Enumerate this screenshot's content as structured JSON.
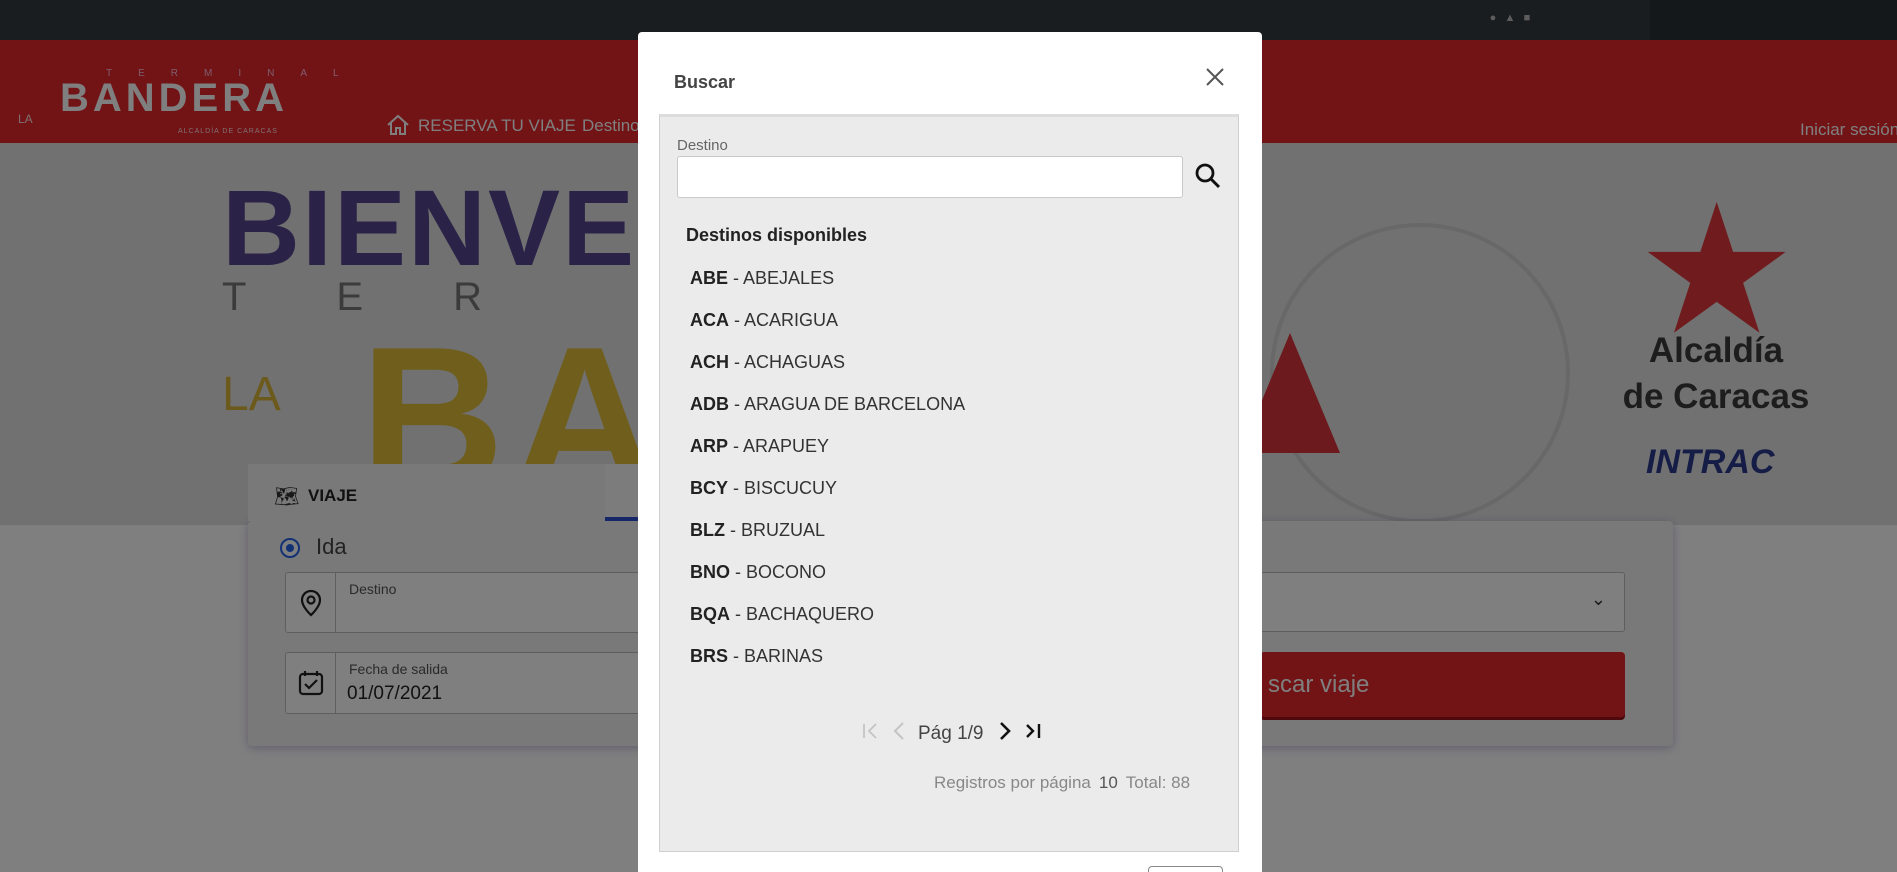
{
  "nav": {
    "logo_main": "BANDERA",
    "logo_la": "LA",
    "logo_top": "TERMINAL",
    "logo_sub": "ALCALDÍA DE CARACAS",
    "reserva": "RESERVA TU VIAJE",
    "destinos": "Destinos",
    "login": "Iniciar sesión"
  },
  "hero": {
    "bienvenidos": "BIENVEN",
    "terminal": "TER",
    "la": "LA",
    "ba": "BA",
    "alcaldia_line1": "Alcaldía",
    "alcaldia_line2": "de Caracas",
    "intrac": "INTRAC"
  },
  "booking": {
    "tab_viaje": "VIAJE",
    "radio_ida": "Ida",
    "destino_label": "Destino",
    "fecha_label": "Fecha de salida",
    "fecha_value": "01/07/2021",
    "buscar_btn": "scar viaje"
  },
  "modal": {
    "title": "Buscar",
    "destino_label": "Destino",
    "destino_value": "",
    "list_title": "Destinos disponibles",
    "items": [
      {
        "code": "ABE",
        "name": "ABEJALES"
      },
      {
        "code": "ACA",
        "name": "ACARIGUA"
      },
      {
        "code": "ACH",
        "name": "ACHAGUAS"
      },
      {
        "code": "ADB",
        "name": "ARAGUA DE BARCELONA"
      },
      {
        "code": "ARP",
        "name": "ARAPUEY"
      },
      {
        "code": "BCY",
        "name": "BISCUCUY"
      },
      {
        "code": "BLZ",
        "name": "BRUZUAL"
      },
      {
        "code": "BNO",
        "name": "BOCONO"
      },
      {
        "code": "BQA",
        "name": "BACHAQUERO"
      },
      {
        "code": "BRS",
        "name": "BARINAS"
      }
    ],
    "pager_label": "Pág 1/9",
    "registros_label": "Registros por página",
    "registros_value": "10",
    "total_label": "Total: 88"
  },
  "colors": {
    "brand_red": "#e5272d",
    "accent_blue": "#2563eb"
  }
}
